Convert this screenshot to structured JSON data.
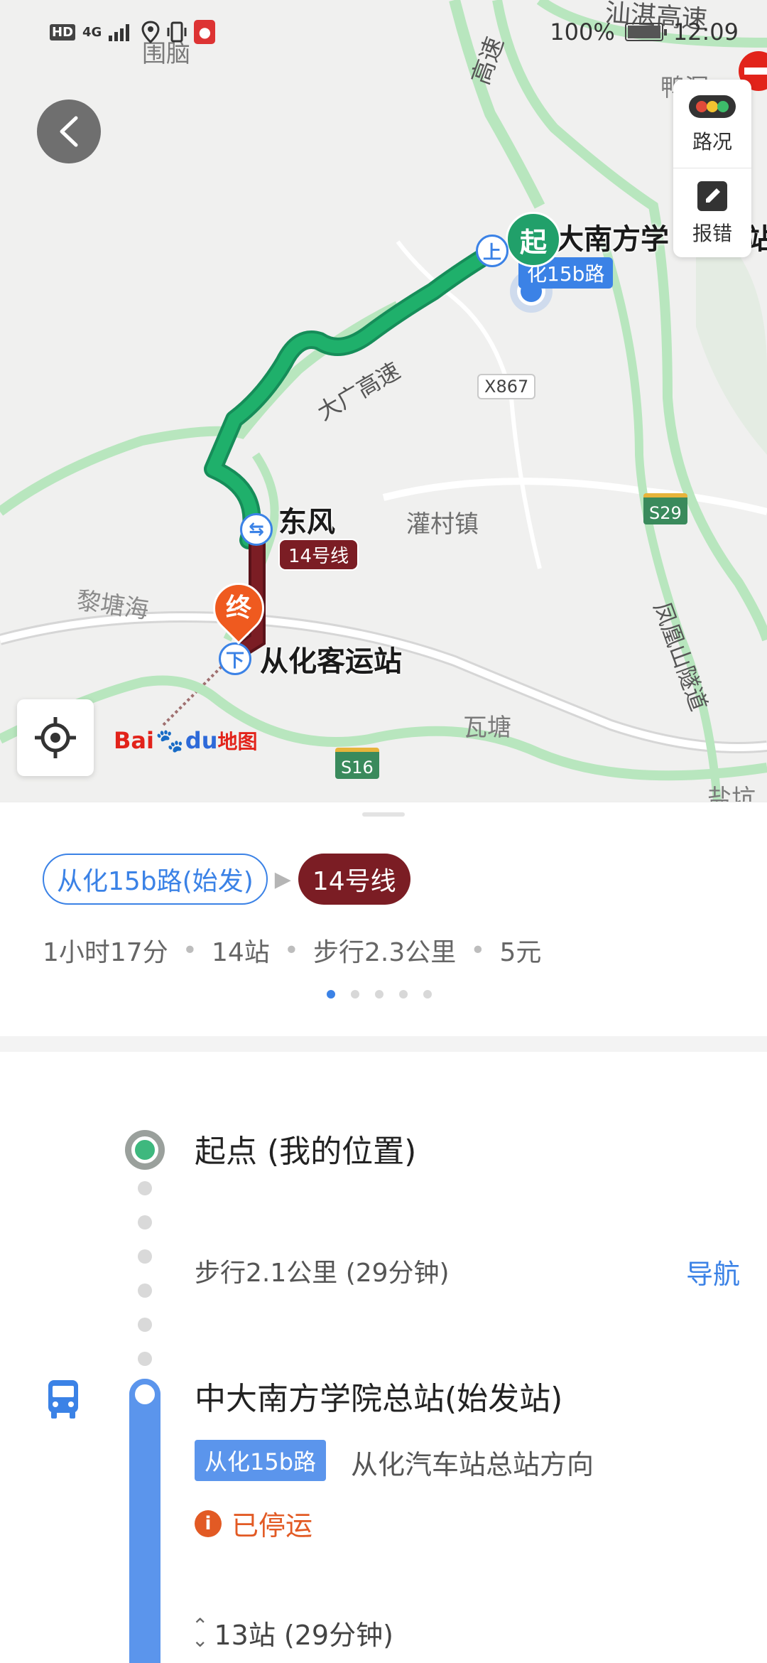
{
  "status_bar": {
    "hd": "HD",
    "network": "4G",
    "battery_text": "100%",
    "battery_level": 1.0,
    "time": "12:09"
  },
  "map": {
    "labels": {
      "top_place": "围脑",
      "top_highway": "汕湛高速",
      "highway_vertical": "高速",
      "right_top_place": "鸭洞",
      "start_station": "大南方学",
      "start_station_suffix": "站",
      "bus_route_tag": "化15b路",
      "road_code": "X867",
      "highway_middle": "大广高速",
      "transfer_station": "东风",
      "transfer_line": "14号线",
      "town": "灌村镇",
      "highway_right_sign": "S29",
      "tunnel": "凤凰山隧道",
      "left_place": "黎塘海",
      "end_station": "从化客运站",
      "south_place": "瓦塘",
      "highway_bottom_sign": "S16",
      "corner_place": "盐坑",
      "start_marker": "起",
      "end_marker": "终",
      "board_icon": "上",
      "alight_icon": "下",
      "transfer_icon": "⇆"
    },
    "tools": [
      {
        "label": "路况",
        "icon": "traffic-light-icon"
      },
      {
        "label": "报错",
        "icon": "edit-icon"
      }
    ],
    "logo": {
      "part1": "Bai",
      "paw": "🐾",
      "part2": "du",
      "suffix": "地图"
    }
  },
  "summary": {
    "segments": [
      {
        "label": "从化15b路(始发)",
        "type": "bus",
        "color": "#3b82e6"
      },
      {
        "label": "14号线",
        "type": "metro",
        "color": "#7b1d24"
      }
    ],
    "duration": "1小时17分",
    "stops": "14站",
    "walk": "步行2.3公里",
    "fare": "5元",
    "pager": {
      "count": 5,
      "active": 0
    }
  },
  "steps": {
    "origin": "起点 (我的位置)",
    "walk": "步行2.1公里 (29分钟)",
    "nav_label": "导航",
    "board_station": "中大南方学院总站(始发站)",
    "route_badge": "从化15b路",
    "direction": "从化汽车站总站方向",
    "status": "已停运",
    "stops_summary": "13站 (29分钟)"
  },
  "colors": {
    "accent_blue": "#3b82e6",
    "route_green": "#1aa364",
    "metro_red": "#7b1d24",
    "warning_orange": "#e25a24"
  }
}
